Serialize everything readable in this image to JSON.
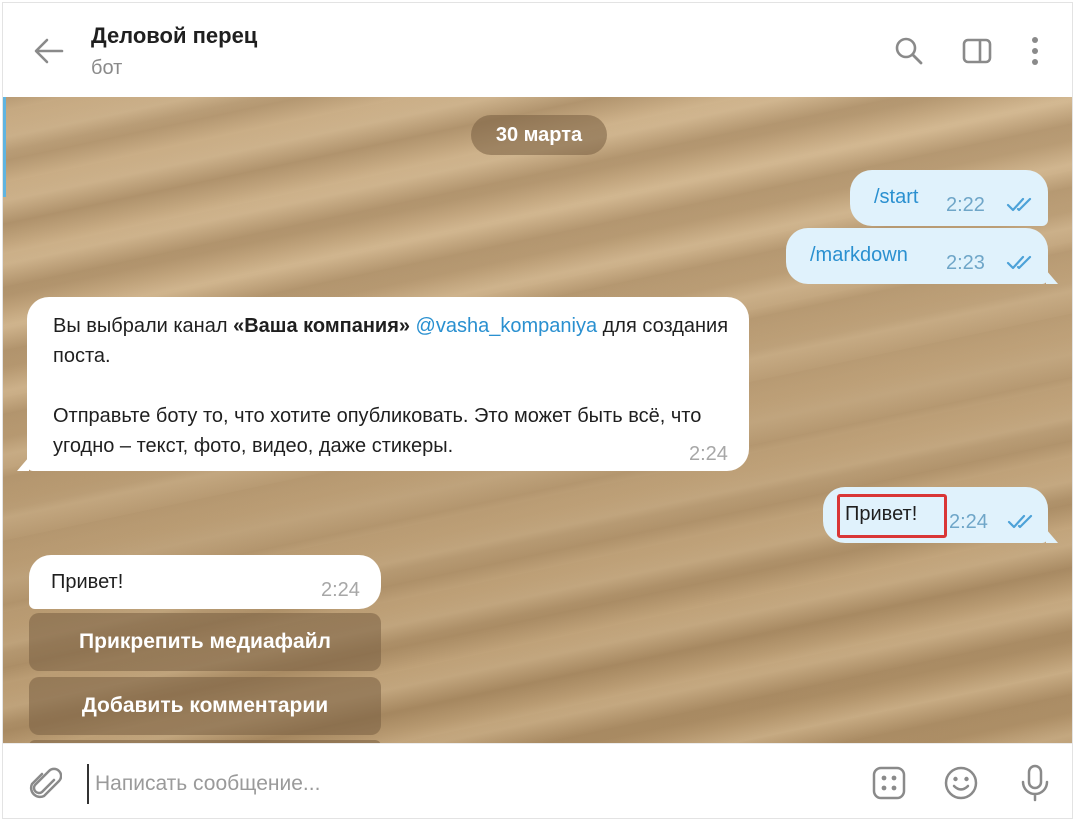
{
  "header": {
    "title": "Деловой перец",
    "subtitle": "бот"
  },
  "chat": {
    "date": "30 марта",
    "messages": [
      {
        "id": "start",
        "direction": "out",
        "text": "/start",
        "time": "2:22"
      },
      {
        "id": "markdown",
        "direction": "out",
        "text": "/markdown",
        "time": "2:23"
      },
      {
        "id": "bot-channel",
        "direction": "in",
        "prefix": "Вы выбрали канал ",
        "channel": "«Ваша компания»",
        "mention": "@vasha_kompaniya",
        "suffix": " для создания поста.",
        "paragraph2": "Отправьте боту то, что хотите опубликовать. Это может быть всё, что угодно – текст, фото, видео, даже стикеры.",
        "time": "2:24"
      },
      {
        "id": "privet-out",
        "direction": "out",
        "text": "Привет!",
        "time": "2:24"
      },
      {
        "id": "privet-in",
        "direction": "in",
        "text": "Привет!",
        "time": "2:24"
      }
    ],
    "keyboard": [
      {
        "label": "Прикрепить медиафайл"
      },
      {
        "label": "Добавить комментарии"
      }
    ]
  },
  "composer": {
    "placeholder": "Написать сообщение..."
  },
  "colors": {
    "outgoing_bubble": "#e0f2fc",
    "incoming_bubble": "#ffffff",
    "link": "#2a90d0",
    "highlight": "#d93636"
  },
  "icons": {
    "back": "arrow-left-icon",
    "search": "search-icon",
    "panel": "sidebar-toggle-icon",
    "more": "more-vertical-icon",
    "attach": "paperclip-icon",
    "commands": "bot-commands-icon",
    "emoji": "emoji-icon",
    "mic": "microphone-icon",
    "read": "double-check-icon"
  }
}
